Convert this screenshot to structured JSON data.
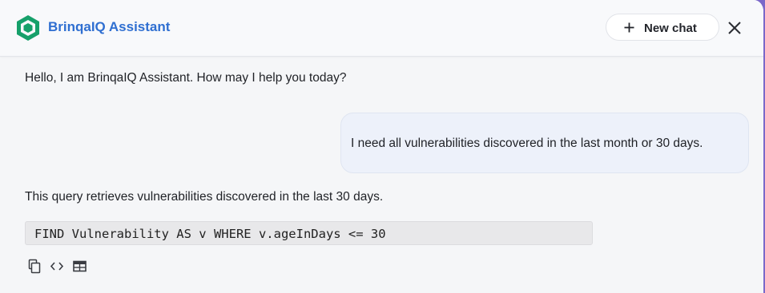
{
  "header": {
    "app_title": "BrinqaIQ Assistant",
    "new_chat_label": "New chat",
    "icons": [
      "brinqa-logo-icon",
      "plus-icon",
      "close-icon"
    ],
    "brand_color": "#2f6fd1"
  },
  "conversation": {
    "assistant_greeting": "Hello, I am BrinqaIQ Assistant. How may I help you today?",
    "user_message": "I need all vulnerabilities discovered in the last month or 30 days.",
    "assistant_reply": "This query retrieves vulnerabilities discovered in the last 30 days.",
    "query_code": "FIND Vulnerability AS v WHERE v.ageInDays <= 30",
    "action_icons": [
      "copy-icon",
      "code-icon",
      "table-icon"
    ]
  }
}
